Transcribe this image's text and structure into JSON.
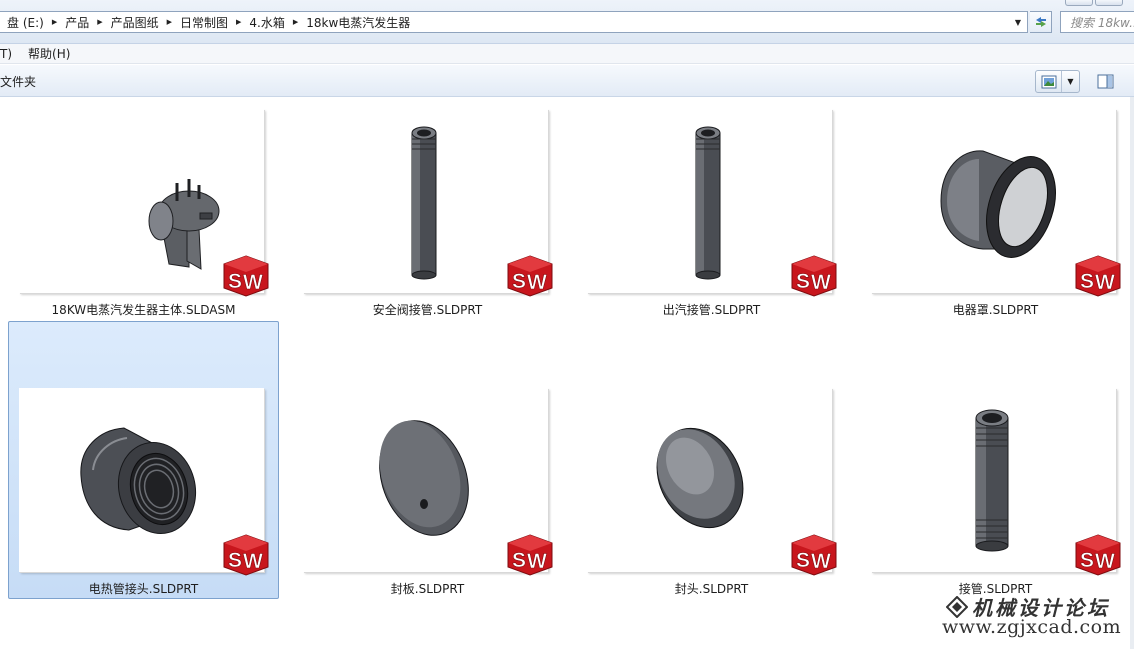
{
  "address_bar": {
    "breadcrumbs": [
      "盘 (E:)",
      "产品",
      "产品图纸",
      "日常制图",
      "4.水箱",
      "18kw电蒸汽发生器"
    ],
    "search_placeholder": "搜索 18kw..."
  },
  "menu": {
    "items": [
      "T)",
      "帮助(H)"
    ]
  },
  "command_bar": {
    "new_folder_label": "文件夹"
  },
  "colors": {
    "selection": "#cde0f7",
    "sw_red": "#d0181e",
    "part_gray": "#4a4d53"
  },
  "files": [
    {
      "name": "18KW电蒸汽发生器主体.SLDASM",
      "icon": "steam-generator-assembly",
      "badge": "SW",
      "selected": false
    },
    {
      "name": "安全阀接管.SLDPRT",
      "icon": "long-pipe-part",
      "badge": "SW",
      "selected": false
    },
    {
      "name": "出汽接管.SLDPRT",
      "icon": "long-pipe-part",
      "badge": "SW",
      "selected": false
    },
    {
      "name": "电器罩.SLDPRT",
      "icon": "flanged-cover-part",
      "badge": "SW",
      "selected": false
    },
    {
      "name": "电热管接头.SLDPRT",
      "icon": "threaded-coupling-part",
      "badge": "SW",
      "selected": true
    },
    {
      "name": "封板.SLDPRT",
      "icon": "disc-plate-part",
      "badge": "SW",
      "selected": false
    },
    {
      "name": "封头.SLDPRT",
      "icon": "dish-head-part",
      "badge": "SW",
      "selected": false
    },
    {
      "name": "接管.SLDPRT",
      "icon": "threaded-pipe-part",
      "badge": "SW",
      "selected": false
    }
  ],
  "watermark": {
    "title": "机械设计论坛",
    "url": "www.zgjxcad.com"
  }
}
